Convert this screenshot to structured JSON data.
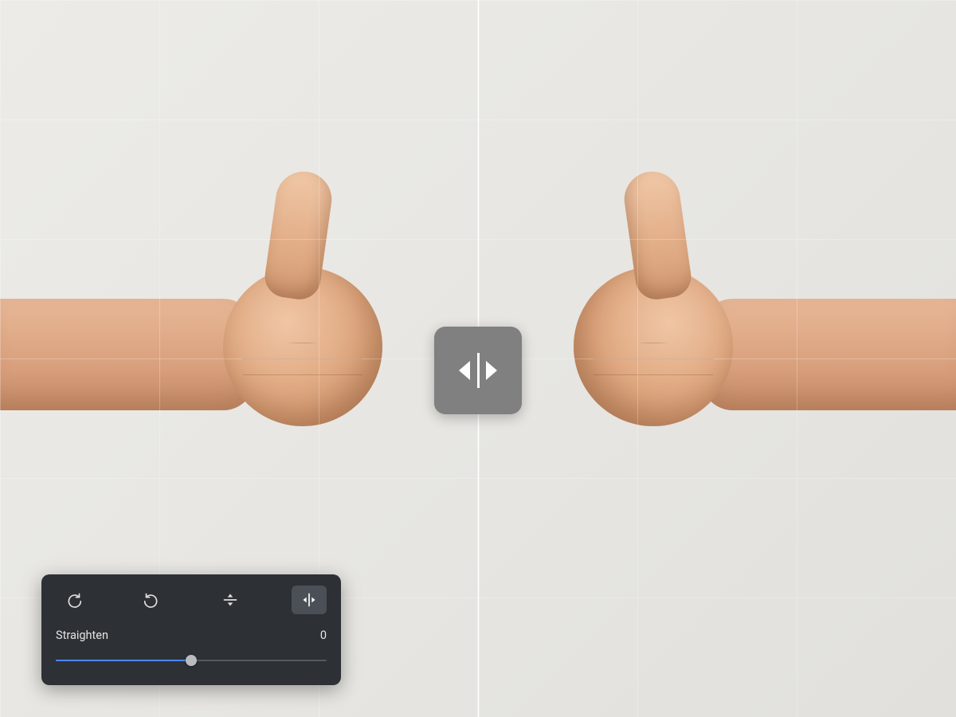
{
  "compare": {
    "handle_icon": "compare-horizontal-icon",
    "divider_position_pct": 50
  },
  "panel": {
    "tools": [
      {
        "name": "rotate-cw",
        "icon": "rotate-cw-icon",
        "active": false
      },
      {
        "name": "rotate-ccw",
        "icon": "rotate-ccw-icon",
        "active": false
      },
      {
        "name": "flip-vertical",
        "icon": "flip-vertical-icon",
        "active": false
      },
      {
        "name": "flip-horizontal",
        "icon": "flip-horizontal-icon",
        "active": true
      }
    ],
    "straighten": {
      "label": "Straighten",
      "value": 0,
      "min": -45,
      "max": 45,
      "slider_position_pct": 50
    }
  },
  "colors": {
    "panel_bg": "#2d3135",
    "accent": "#4e86ff",
    "handle_bg": "#808080"
  }
}
